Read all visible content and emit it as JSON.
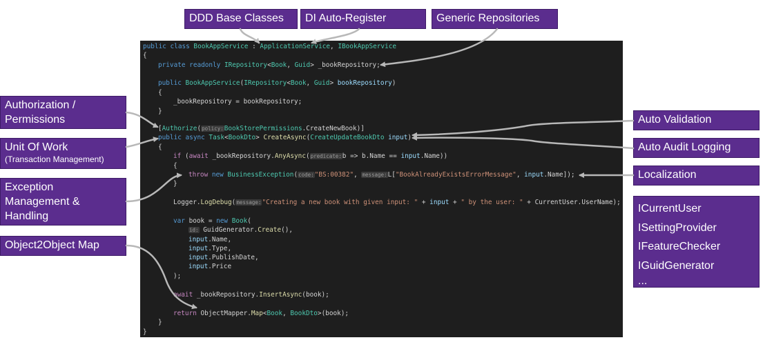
{
  "labels": {
    "ddd": "DDD Base Classes",
    "di": "DI Auto-Register",
    "generic_repos": "Generic Repositories",
    "authorization_l1": "Authorization /",
    "authorization_l2": "Permissions",
    "uow": "Unit Of Work",
    "uow_sub": "(Transaction Management)",
    "exception_l1": "Exception",
    "exception_l2": "Management &",
    "exception_l3": "Handling",
    "object_map": "Object2Object Map",
    "auto_validation": "Auto Validation",
    "auto_audit": "Auto Audit Logging",
    "localization": "Localization",
    "services": [
      "ICurrentUser",
      "ISettingProvider",
      "IFeatureChecker",
      "IGuidGenerator",
      "..."
    ]
  },
  "code": {
    "l1": [
      "public",
      "class",
      "BookAppService",
      ":",
      "ApplicationService",
      ",",
      "IBookAppService"
    ],
    "l2": "{",
    "l3": [
      "private",
      "readonly",
      "IRepository",
      "<",
      "Book",
      ",",
      "Guid",
      ">",
      "_bookRepository;"
    ],
    "l4": [
      "public",
      "BookAppService",
      "(",
      "IRepository",
      "<",
      "Book",
      ",",
      "Guid",
      ">",
      "bookRepository",
      ")"
    ],
    "l5": "{",
    "l6": [
      "_bookRepository = bookRepository;"
    ],
    "l7": "}",
    "l8": [
      "[",
      "Authorize",
      "(",
      "policy:",
      "BookStorePermissions",
      ".CreateNewBook)]"
    ],
    "l9": [
      "public",
      "async",
      "Task",
      "<",
      "BookDto",
      ">",
      "CreateAsync",
      "(",
      "CreateUpdateBookDto",
      "input",
      ")"
    ],
    "l10": "{",
    "l11": [
      "if",
      "(",
      "await",
      "_bookRepository.",
      "AnyAsync",
      "(",
      "predicate:",
      "b => b.Name == ",
      "input",
      ".Name))"
    ],
    "l12": "{",
    "l13": [
      "throw",
      "new",
      "BusinessException",
      "(",
      "code:",
      "\"BS:00382\"",
      ",",
      "message:",
      "L[",
      "\"BookAlreadyExistsErrorMessage\"",
      ",",
      "input",
      ".Name]);"
    ],
    "l14": "}",
    "l15": [
      "Logger.",
      "LogDebug",
      "(",
      "message:",
      "\"Creating a new book with given input: \"",
      " + ",
      "input",
      " + ",
      "\" by the user: \"",
      " + CurrentUser.UserName);"
    ],
    "l16": [
      "var",
      "book = ",
      "new",
      "Book",
      "("
    ],
    "l17": [
      "id:",
      "GuidGenerator.",
      "Create",
      "(),"
    ],
    "l18": [
      "input",
      ".Name,"
    ],
    "l19": [
      "input",
      ".Type,"
    ],
    "l20": [
      "input",
      ".PublishDate,"
    ],
    "l21": [
      "input",
      ".Price"
    ],
    "l22": ");",
    "l23": [
      "await",
      "_bookRepository.",
      "InsertAsync",
      "(book);"
    ],
    "l24": [
      "return",
      "ObjectMapper.",
      "Map",
      "<",
      "Book",
      ",",
      "BookDto",
      ">",
      "(book);"
    ],
    "l25": "}",
    "l26": "}"
  },
  "colors": {
    "label_bg": "#5b2d8e",
    "code_bg": "#1e1e1e",
    "arrow": "#b8b8b8"
  }
}
